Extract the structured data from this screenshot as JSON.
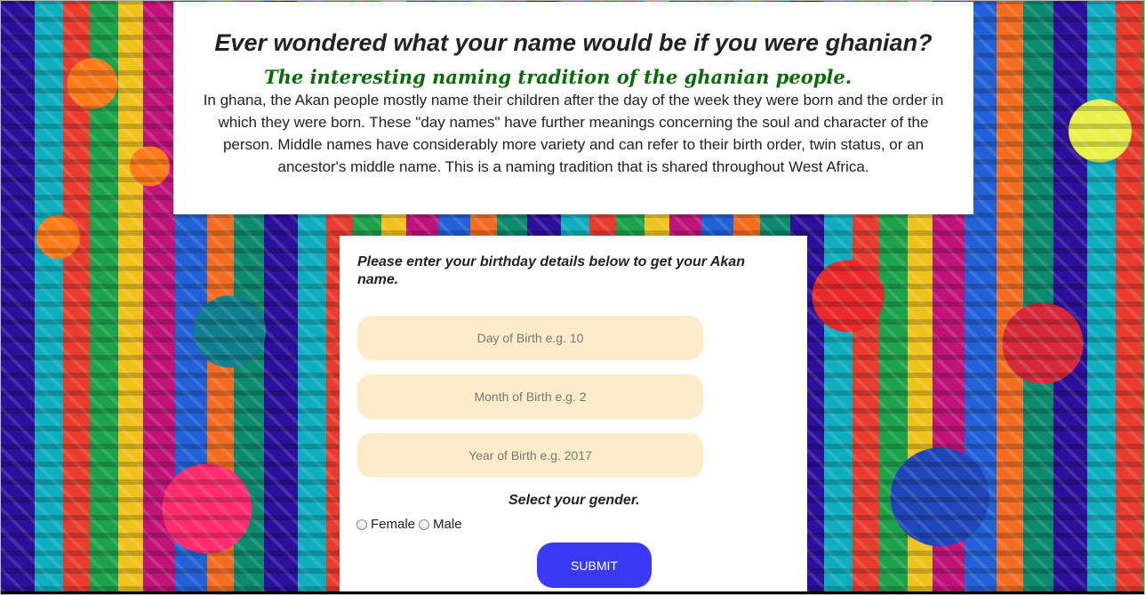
{
  "intro": {
    "title": "Ever wondered what your name would be if you were ghanian?",
    "subtitle": "The interesting naming tradition of the ghanian people.",
    "description": "In ghana, the Akan people mostly name their children after the day of the week they were born and the order in which they were born. These \"day names\" have further meanings concerning the soul and character of the person. Middle names have considerably more variety and can refer to their birth order, twin status, or an ancestor's middle name. This is a naming tradition that is shared throughout West Africa."
  },
  "form": {
    "heading": "Please enter your birthday details below to get your Akan name.",
    "day": {
      "placeholder": "Day of Birth e.g. 10",
      "value": ""
    },
    "month": {
      "placeholder": "Month of Birth e.g. 2",
      "value": ""
    },
    "year": {
      "placeholder": "Year of Birth e.g. 2017",
      "value": ""
    },
    "gender_label": "Select your gender.",
    "gender_options": [
      {
        "label": "Female",
        "selected": false
      },
      {
        "label": "Male",
        "selected": false
      }
    ],
    "submit_label": "SUBMIT"
  },
  "colors": {
    "card_background": "#ffffff",
    "input_background": "#fdebc9",
    "subtitle_green": "#0a6b0a",
    "submit_blue": "#3a3af5"
  }
}
